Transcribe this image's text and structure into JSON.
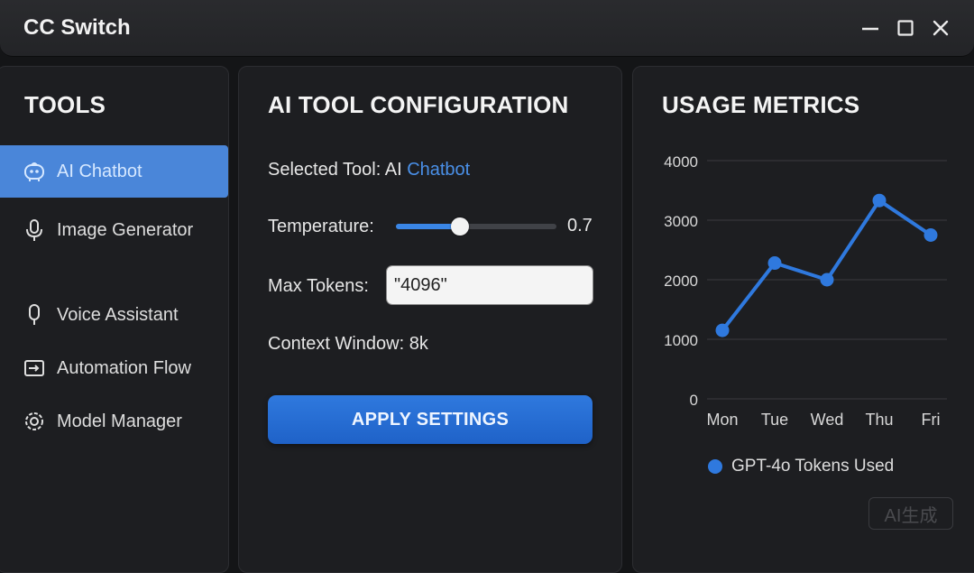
{
  "window": {
    "title": "CC Switch"
  },
  "sidebar": {
    "title": "TOOLS",
    "items": [
      {
        "label": "AI Chatbot",
        "icon": "chatbot-icon",
        "active": true
      },
      {
        "label": "Image Generator",
        "icon": "microphone-icon",
        "active": false
      },
      {
        "label": "Voice Assistant",
        "icon": "microphone-outline-icon",
        "active": false
      },
      {
        "label": "Automation Flow",
        "icon": "flow-icon",
        "active": false
      },
      {
        "label": "Model Manager",
        "icon": "gear-icon",
        "active": false
      }
    ]
  },
  "config": {
    "title": "AI TOOL CONFIGURATION",
    "selected_label": "Selected Tool: AI",
    "selected_value": "Chatbot",
    "temperature_label": "Temperature:",
    "temperature_value": "0.7",
    "temperature_fraction": 0.4,
    "max_tokens_label": "Max Tokens:",
    "max_tokens_value": "\"4096\"",
    "context_window": "Context Window: 8k",
    "apply_label": "APPLY SETTINGS"
  },
  "metrics": {
    "title": "USAGE METRICS",
    "watermark": "AI生成"
  },
  "colors": {
    "accent": "#2f79de",
    "sidebar_active": "#4a86d9"
  },
  "chart_data": {
    "type": "line",
    "categories": [
      "Mon",
      "Tue",
      "Wed",
      "Thu",
      "Fri"
    ],
    "series": [
      {
        "name": "GPT-4o Tokens Used",
        "values": [
          1150,
          2280,
          2000,
          3330,
          2750
        ]
      }
    ],
    "ylim": [
      0,
      4000
    ],
    "yticks": [
      0,
      1000,
      2000,
      3000,
      4000
    ],
    "grid": true,
    "legend": "bottom"
  }
}
